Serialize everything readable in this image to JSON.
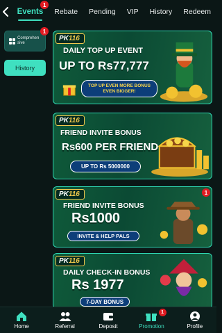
{
  "tabs": [
    {
      "label": "Events",
      "active": true,
      "badge": "1"
    },
    {
      "label": "Rebate"
    },
    {
      "label": "Pending"
    },
    {
      "label": "VIP"
    },
    {
      "label": "History"
    },
    {
      "label": "Redeem"
    }
  ],
  "sidebar": {
    "comprehensive_label": "Comprehen sive",
    "comprehensive_badge": "1",
    "history_label": "History"
  },
  "banners": [
    {
      "brand_pk": "PK",
      "brand_num": "116",
      "title": "DAILY TOP UP EVENT",
      "amount": "UP TO Rs77,777",
      "pill": "TOP UP EVEN MORE BONUS EVEN BIGGER!"
    },
    {
      "brand_pk": "PK",
      "brand_num": "116",
      "title": "FRIEND INVITE BONUS",
      "amount": "Rs600 PER FRIEND",
      "pill": "UP TO Rs 5000000"
    },
    {
      "brand_pk": "PK",
      "brand_num": "116",
      "title": "FRIEND INVITE BONUS",
      "amount": "Rs1000",
      "pill": "INVITE & HELP PALS",
      "badge": "1"
    },
    {
      "brand_pk": "PK",
      "brand_num": "116",
      "title": "DAILY CHECK-IN BONUS",
      "amount": "Rs 1977",
      "pill": "7-DAY BONUS"
    }
  ],
  "bottom_nav": [
    {
      "label": "Home",
      "icon": "home-icon"
    },
    {
      "label": "Referral",
      "icon": "users-icon"
    },
    {
      "label": "Deposit",
      "icon": "wallet-icon"
    },
    {
      "label": "Promotion",
      "icon": "gift-icon",
      "active": true,
      "badge": "1"
    },
    {
      "label": "Profile",
      "icon": "user-icon"
    }
  ],
  "colors": {
    "accent": "#3fe0c0",
    "background": "#0b1716",
    "badge": "#e11b22",
    "banner_green": "#0f5a3a",
    "gold": "#f7d54a"
  }
}
